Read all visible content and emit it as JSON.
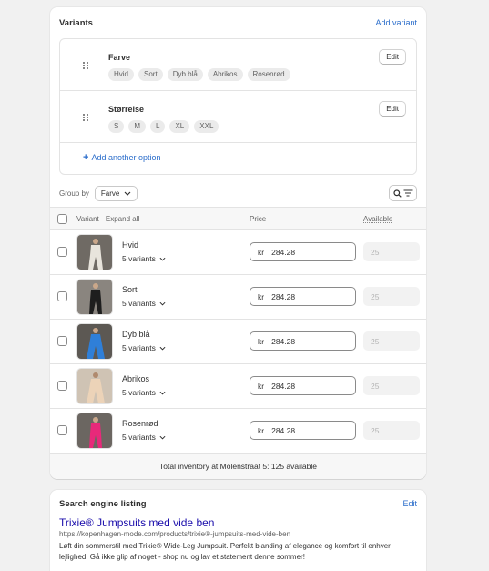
{
  "variants_card": {
    "title": "Variants",
    "add_variant_label": "Add variant",
    "options": [
      {
        "name": "Farve",
        "values": [
          "Hvid",
          "Sort",
          "Dyb blå",
          "Abrikos",
          "Rosenrød"
        ],
        "edit_label": "Edit"
      },
      {
        "name": "Størrelse",
        "values": [
          "S",
          "M",
          "L",
          "XL",
          "XXL"
        ],
        "edit_label": "Edit"
      }
    ],
    "add_option_label": "Add another option",
    "group_by": {
      "label": "Group by",
      "selected": "Farve"
    },
    "table": {
      "headers": {
        "variant": "Variant",
        "expand_all": "· Expand all",
        "price": "Price",
        "available": "Available"
      },
      "rows": [
        {
          "name": "Hvid",
          "count": "5 variants",
          "currency": "kr",
          "price": "284.28",
          "available": "25",
          "swatch": "#e8e4dc"
        },
        {
          "name": "Sort",
          "count": "5 variants",
          "currency": "kr",
          "price": "284.28",
          "available": "25",
          "swatch": "#1e1e1e"
        },
        {
          "name": "Dyb blå",
          "count": "5 variants",
          "currency": "kr",
          "price": "284.28",
          "available": "25",
          "swatch": "#2f7fd8"
        },
        {
          "name": "Abrikos",
          "count": "5 variants",
          "currency": "kr",
          "price": "284.28",
          "available": "25",
          "swatch": "#ecd3b8"
        },
        {
          "name": "Rosenrød",
          "count": "5 variants",
          "currency": "kr",
          "price": "284.28",
          "available": "25",
          "swatch": "#e8297a"
        }
      ]
    },
    "total_inventory": "Total inventory at Molenstraat 5: 125 available"
  },
  "seo_card": {
    "title": "Search engine listing",
    "edit_label": "Edit",
    "page_title": "Trixie® Jumpsuits med vide ben",
    "url": "https://kopenhagen-mode.com/products/trixie®-jumpsuits-med-vide-ben",
    "description": "Løft din sommerstil med Trixie® Wide-Leg Jumpsuit. Perfekt blanding af elegance og komfort til enhver lejlighed. Gå ikke glip af noget - shop nu og lav et statement denne sommer!"
  },
  "colors": {
    "link": "#2c6ecb",
    "seo_title": "#1a0dab",
    "background": "#f1f1f1"
  },
  "icons": [
    "drag-handle-icon",
    "plus-icon",
    "chevron-down-icon",
    "search-icon",
    "filter-icon"
  ]
}
